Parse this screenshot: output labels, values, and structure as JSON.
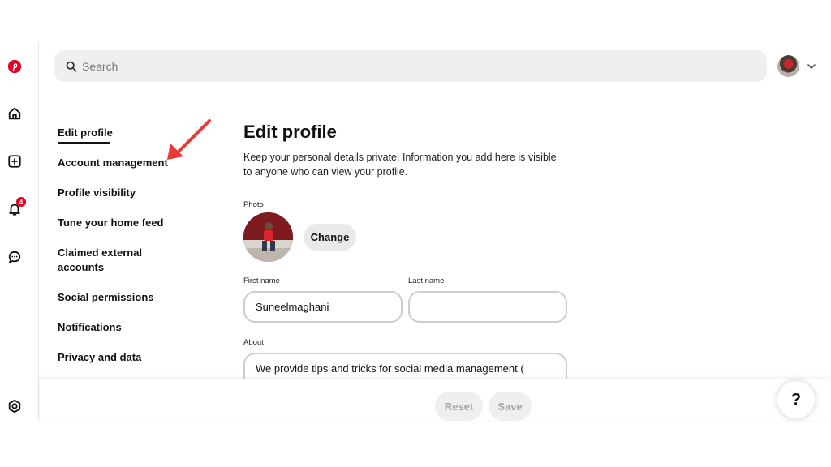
{
  "search": {
    "placeholder": "Search"
  },
  "rail": {
    "notification_count": "4"
  },
  "nav": {
    "items": [
      {
        "label": "Edit profile"
      },
      {
        "label": "Account management"
      },
      {
        "label": "Profile visibility"
      },
      {
        "label": "Tune your home feed"
      },
      {
        "label": "Claimed external accounts"
      },
      {
        "label": "Social permissions"
      },
      {
        "label": "Notifications"
      },
      {
        "label": "Privacy and data"
      }
    ]
  },
  "main": {
    "title": "Edit profile",
    "description": "Keep your personal details private. Information you add here is visible to anyone who can view your profile.",
    "photo_label": "Photo",
    "change_label": "Change",
    "first_name_label": "First name",
    "first_name_value": "Suneelmaghani",
    "last_name_label": "Last name",
    "last_name_value": "",
    "about_label": "About",
    "about_value": "We provide tips and tricks for social media management ("
  },
  "footer": {
    "reset_label": "Reset",
    "save_label": "Save"
  },
  "help": {
    "label": "?"
  },
  "colors": {
    "brand": "#e60023",
    "annotation_arrow": "#ea3a36"
  }
}
